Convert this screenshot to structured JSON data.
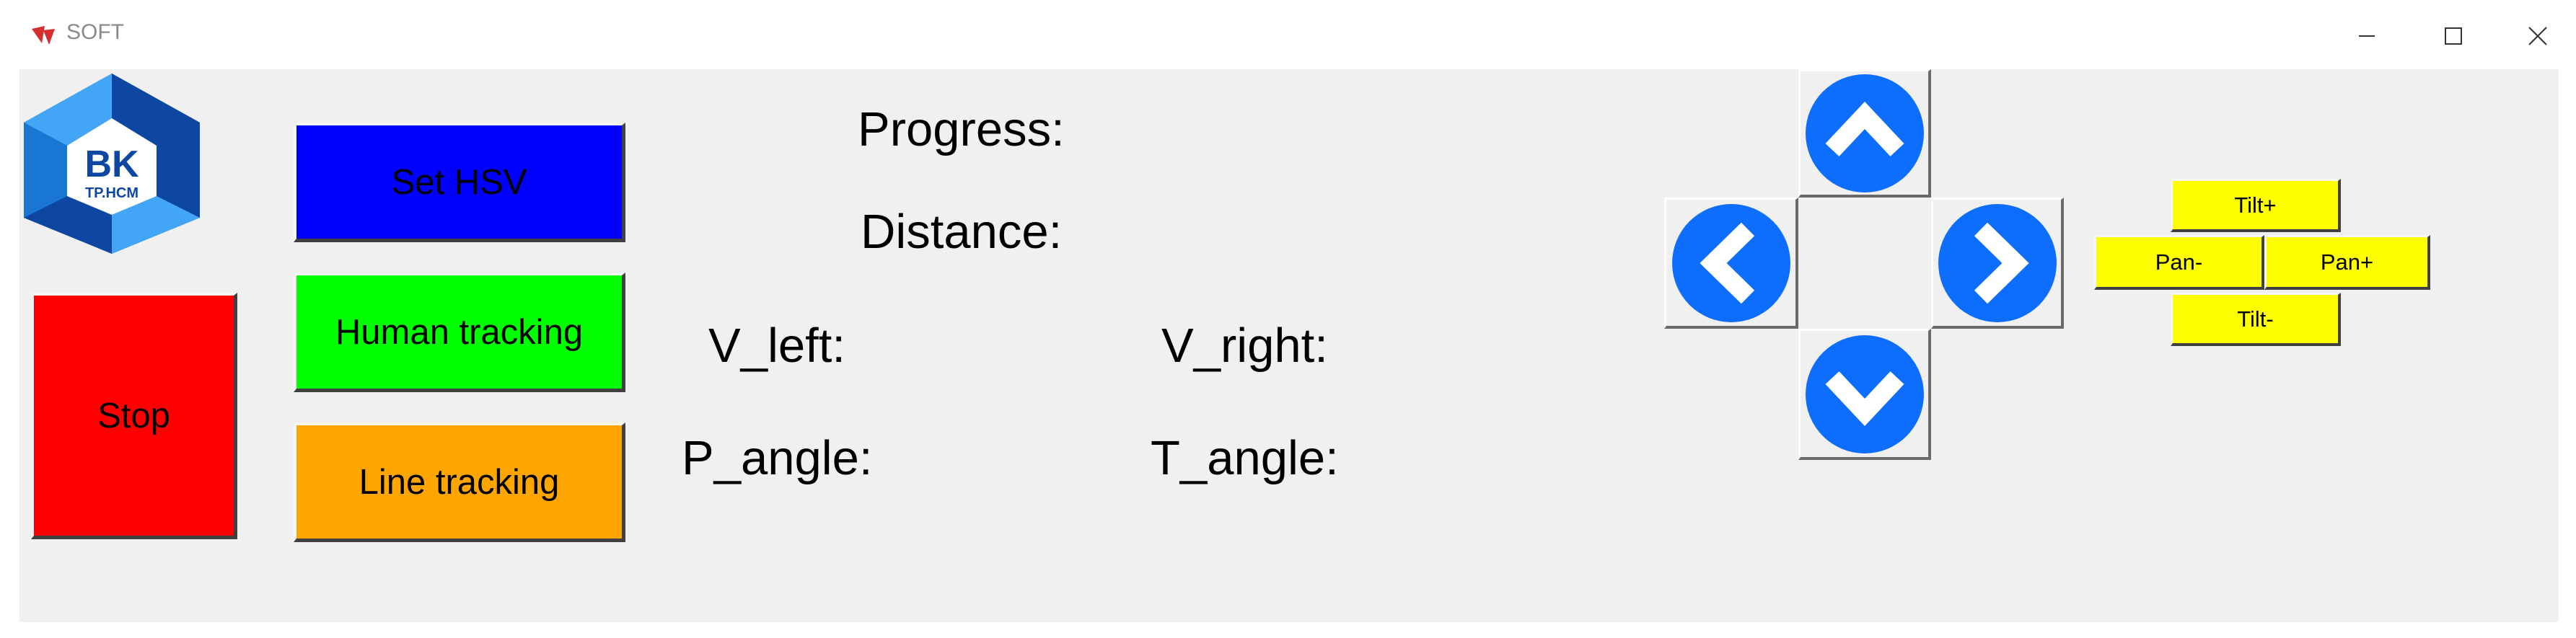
{
  "window": {
    "title": "SOFT",
    "tk_icon": "Tk"
  },
  "window_controls": {
    "minimize_icon": "minimize-icon",
    "maximize_icon": "maximize-icon",
    "close_icon": "close-icon"
  },
  "logo": {
    "main": "BK",
    "sub": "TP.HCM"
  },
  "buttons": {
    "set_hsv": "Set HSV",
    "human_tracking": "Human tracking",
    "line_tracking": "Line tracking",
    "stop": "Stop"
  },
  "readouts": {
    "progress": "Progress:",
    "distance": "Distance:",
    "v_left": "V_left:",
    "v_right": "V_right:",
    "p_angle": "P_angle:",
    "t_angle": "T_angle:"
  },
  "camera": {
    "tilt_plus": "Tilt+",
    "tilt_minus": "Tilt-",
    "pan_minus": "Pan-",
    "pan_plus": "Pan+"
  },
  "colors": {
    "set_hsv": "#0000ff",
    "human_tracking": "#00ff00",
    "line_tracking": "#ffa500",
    "stop": "#ff0000",
    "camera_buttons": "#ffff00",
    "arrow_circle": "#0d6efd",
    "background": "#f0f0f0"
  }
}
